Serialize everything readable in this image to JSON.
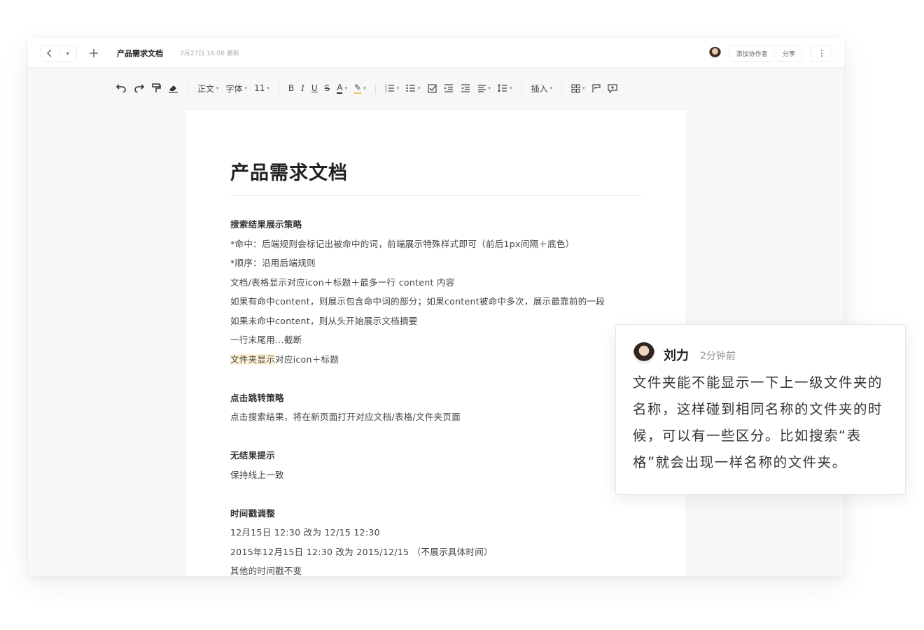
{
  "topbar": {
    "back_icon": "chevron-left-icon",
    "history_icon": "caret-down-icon",
    "new_icon": "plus-icon",
    "doc_name": "产品需求文档",
    "updated": "7月27日 16:00 更新",
    "collab_label": "添加协作者",
    "share_label": "分享",
    "more_icon": "more-vertical-icon"
  },
  "toolbar": {
    "undo": "↶",
    "redo": "↷",
    "format_painter": "⌐",
    "eraser": "⌫",
    "paragraph": "正文",
    "font": "字体",
    "size": "11",
    "bold": "B",
    "italic": "I",
    "underline": "U",
    "strike": "S",
    "font_color": "A",
    "highlight": "✎",
    "ordered_list": "⁝≡",
    "bullet_list": "⁝≡",
    "checkbox": "☑",
    "indent": "⇥",
    "outdent": "⇤",
    "align": "≡",
    "line_height": "↕≡",
    "insert": "插入",
    "table": "⊞",
    "format": "⌜",
    "comment": "⊕"
  },
  "doc": {
    "title": "产品需求文档",
    "lines": [
      {
        "text": "搜索结果展示策略",
        "type": "h"
      },
      {
        "text": "*命中：后端规则会标记出被命中的词，前端展示特殊样式即可（前后1px间隔＋底色）",
        "type": "p"
      },
      {
        "text": "*顺序：沿用后端规则",
        "type": "p"
      },
      {
        "text": "文档/表格显示对应icon＋标题＋最多一行 content 内容",
        "type": "p"
      },
      {
        "text": "如果有命中content，则展示包含命中词的部分；如果content被命中多次，展示最靠前的一段",
        "type": "p"
      },
      {
        "text": "如果未命中content，则从头开始展示文档摘要",
        "type": "p"
      },
      {
        "text": "一行末尾用...截断",
        "type": "p"
      },
      {
        "text": "文件夹显示",
        "type": "p-hl",
        "rest": "对应icon＋标题"
      },
      {
        "text": "",
        "type": "blank"
      },
      {
        "text": "点击跳转策略",
        "type": "h"
      },
      {
        "text": "点击搜索结果，将在新页面打开对应文档/表格/文件夹页面",
        "type": "p"
      },
      {
        "text": "",
        "type": "blank"
      },
      {
        "text": "无结果提示",
        "type": "h"
      },
      {
        "text": "保持线上一致",
        "type": "p"
      },
      {
        "text": "",
        "type": "blank"
      },
      {
        "text": "时间戳调整",
        "type": "h"
      },
      {
        "text": "12月15日 12:30 改为 12/15 12:30",
        "type": "p"
      },
      {
        "text": "2015年12月15日 12:30 改为 2015/12/15 （不展示具体时间）",
        "type": "p"
      },
      {
        "text": "其他的时间戳不变",
        "type": "p"
      }
    ]
  },
  "comment": {
    "author": "刘力",
    "time": "2分钟前",
    "text": "文件夹能不能显示一下上一级文件夹的名称，这样碰到相同名称的文件夹的时候，可以有一些区分。比如搜索“表格”就会出现一样名称的文件夹。"
  }
}
